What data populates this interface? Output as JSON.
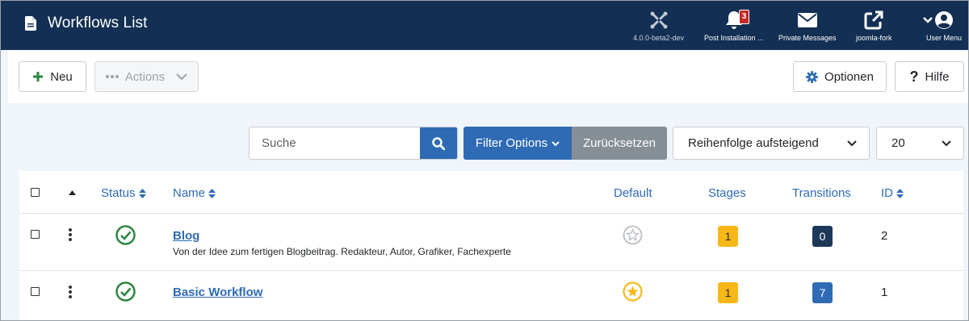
{
  "header": {
    "title": "Workflows List",
    "items": [
      {
        "label": "4.0.0-beta2-dev",
        "icon": "joomla-icon"
      },
      {
        "label": "Post Installation ...",
        "icon": "bell-icon",
        "badge": "3"
      },
      {
        "label": "Private Messages",
        "icon": "envelope-icon"
      },
      {
        "label": "joomla-fork",
        "icon": "external-link-icon"
      },
      {
        "label": "User Menu",
        "icon": "user-icon"
      }
    ],
    "colors": {
      "background": "#132f53",
      "badge": "#c52827"
    }
  },
  "toolbar": {
    "new_label": "Neu",
    "actions_label": "Actions",
    "options_label": "Optionen",
    "help_label": "Hilfe"
  },
  "filters": {
    "search_placeholder": "Suche",
    "filter_options_label": "Filter Options",
    "reset_label": "Zurücksetzen",
    "ordering_selected": "Reihenfolge aufsteigend",
    "limit_selected": "20"
  },
  "table": {
    "columns": {
      "status": "Status",
      "name": "Name",
      "default": "Default",
      "stages": "Stages",
      "transitions": "Transitions",
      "id": "ID"
    },
    "rows": [
      {
        "name": "Blog",
        "description": "Von der Idee zum fertigen Blogbeitrag. Redakteur, Autor, Grafiker, Fachexperte",
        "published": true,
        "default": false,
        "stages": "1",
        "transitions": "0",
        "id": "2"
      },
      {
        "name": "Basic Workflow",
        "description": "",
        "published": true,
        "default": true,
        "stages": "1",
        "transitions": "7",
        "id": "1"
      }
    ]
  },
  "colors": {
    "primary": "#2f6bb5",
    "success": "#2e8540",
    "warning": "#f7b817",
    "navy": "#1d3858",
    "secondary": "#868e96"
  }
}
